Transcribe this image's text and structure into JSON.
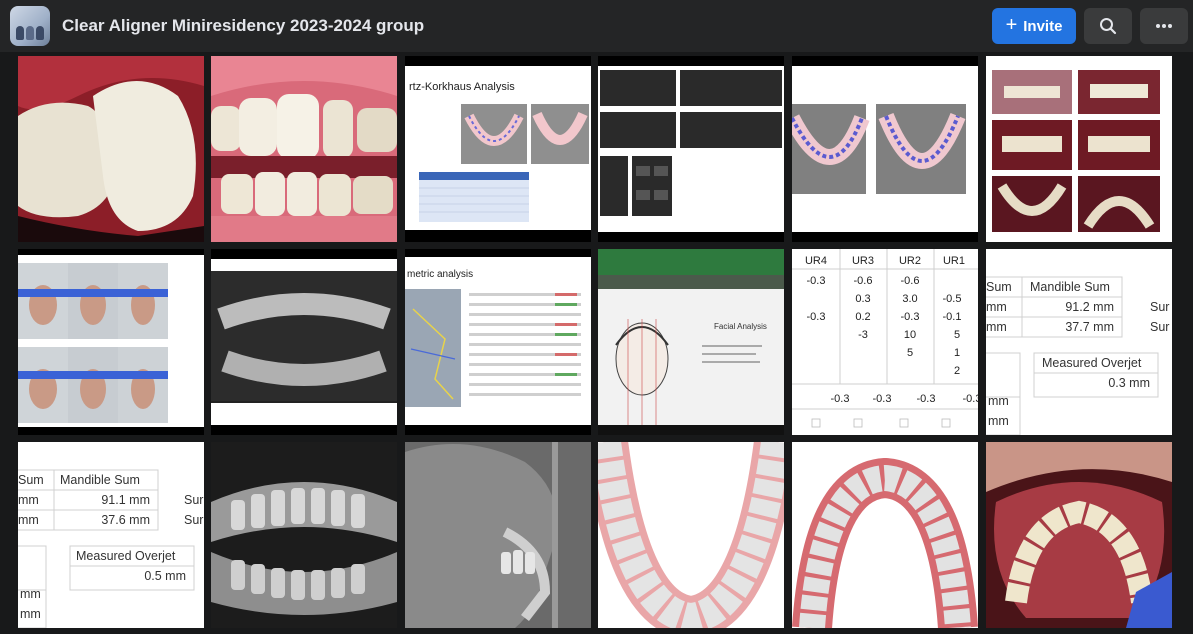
{
  "header": {
    "group_title": "Clear Aligner Miniresidency 2023-2024 group",
    "invite_label": "Invite",
    "icons": {
      "invite": "plus-icon",
      "search": "search-icon",
      "more": "more-horizontal-icon"
    }
  },
  "photos": [
    {
      "alt": "Intraoral photo of crossbite incisor"
    },
    {
      "alt": "Intraoral frontal photo"
    },
    {
      "alt": "Bolton/Korkhaus analysis slide",
      "title": "rtz-Korkhaus Analysis"
    },
    {
      "alt": "Spreadsheet measurement tables"
    },
    {
      "alt": "3D dental arch scans"
    },
    {
      "alt": "Intraoral photo series"
    },
    {
      "alt": "Extraoral profile photo series"
    },
    {
      "alt": "Panoramic radiograph"
    },
    {
      "alt": "Cephalometric analysis slide",
      "title": "metric analysis"
    },
    {
      "alt": "Facial analysis on monitor",
      "title": "Facial Analysis"
    },
    {
      "alt": "Tooth movement table",
      "headers": [
        "UR4",
        "UR3",
        "UR2",
        "UR1"
      ],
      "rows": [
        [
          "-0.3",
          "-0.6",
          "-0.6",
          ""
        ],
        [
          "",
          "0.3",
          "3.0",
          "-0.5"
        ],
        [
          "-0.3",
          "0.2",
          "-0.3",
          "-0.1"
        ],
        [
          "",
          "-3",
          "10",
          "5"
        ],
        [
          "",
          "",
          "5",
          "1"
        ],
        [
          "",
          "",
          "",
          "2"
        ]
      ],
      "bottom_row": [
        "-0.3",
        "-0.3",
        "-0.3",
        "-0.3"
      ]
    },
    {
      "alt": "Arch sum summary",
      "left_header": "Sum",
      "right_header": "Mandible Sum",
      "right_values": [
        "91.2 mm",
        "37.7 mm"
      ],
      "left_values": [
        "mm",
        "mm"
      ],
      "edge_values": [
        "Sur",
        "Sur"
      ],
      "overjet_label": "Measured Overjet",
      "overjet_value": "0.3 mm",
      "lower_left": [
        "mm",
        "mm"
      ]
    },
    {
      "alt": "Arch sum summary 2",
      "left_header": "Sum",
      "right_header": "Mandible Sum",
      "right_values": [
        "91.1 mm",
        "37.6 mm"
      ],
      "left_values": [
        "mm",
        "mm"
      ],
      "edge_values": [
        "Sur",
        "Sur"
      ],
      "overjet_label": "Measured Overjet",
      "overjet_value": "0.5 mm",
      "lower_left": [
        "mm",
        "mm"
      ]
    },
    {
      "alt": "Panoramic radiograph close-up"
    },
    {
      "alt": "Lateral cephalogram"
    },
    {
      "alt": "3D upper arch scan"
    },
    {
      "alt": "3D lower arch scan"
    },
    {
      "alt": "Intraoral occlusal photo"
    }
  ],
  "colors": {
    "topbar": "#242526",
    "background": "#18191a",
    "accent": "#2374e1",
    "button": "#3a3b3c"
  }
}
